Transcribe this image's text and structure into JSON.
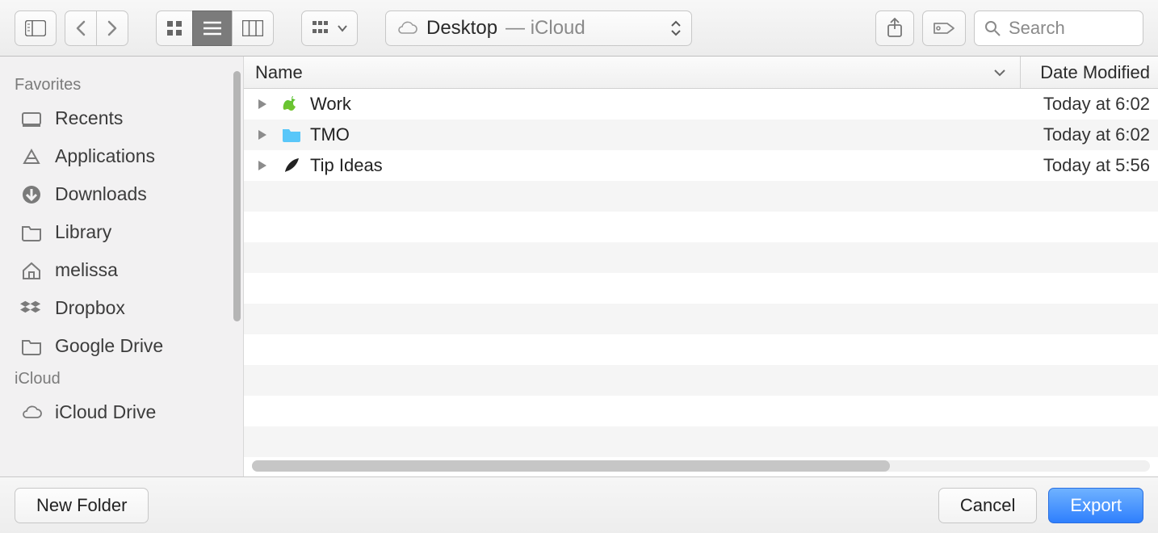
{
  "toolbar": {
    "location_name": "Desktop",
    "location_suffix": " — iCloud",
    "search_placeholder": "Search"
  },
  "sidebar": {
    "sections": [
      {
        "title": "Favorites",
        "items": [
          {
            "icon": "recents",
            "label": "Recents"
          },
          {
            "icon": "app",
            "label": "Applications"
          },
          {
            "icon": "download",
            "label": "Downloads"
          },
          {
            "icon": "folder",
            "label": "Library"
          },
          {
            "icon": "home",
            "label": "melissa"
          },
          {
            "icon": "dropbox",
            "label": "Dropbox"
          },
          {
            "icon": "folder",
            "label": "Google Drive"
          }
        ]
      },
      {
        "title": "iCloud",
        "items": [
          {
            "icon": "cloud",
            "label": "iCloud Drive"
          }
        ]
      }
    ]
  },
  "columns": {
    "name": "Name",
    "date": "Date Modified"
  },
  "files": [
    {
      "icon": "apple",
      "name": "Work",
      "date": "Today at 6:02"
    },
    {
      "icon": "bluefolder",
      "name": "TMO",
      "date": "Today at 6:02"
    },
    {
      "icon": "feather",
      "name": "Tip Ideas",
      "date": "Today at 5:56"
    }
  ],
  "footer": {
    "new_folder": "New Folder",
    "cancel": "Cancel",
    "export": "Export"
  }
}
